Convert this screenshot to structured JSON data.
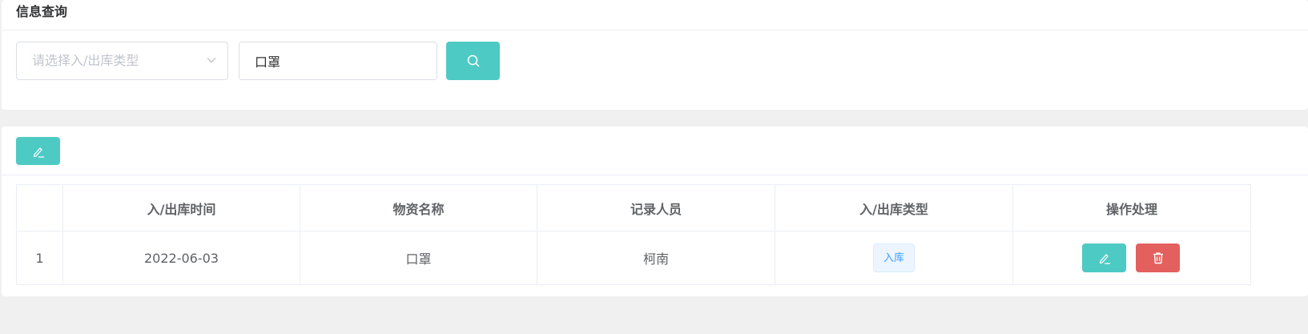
{
  "query": {
    "title": "信息查询",
    "type_select": {
      "placeholder": "请选择入/出库类型",
      "value": ""
    },
    "keyword_input": {
      "value": "口罩"
    },
    "search_icon": "search-icon"
  },
  "toolbar": {
    "add_icon": "edit-icon"
  },
  "table": {
    "columns": [
      "",
      "入/出库时间",
      "物资名称",
      "记录人员",
      "入/出库类型",
      "操作处理"
    ],
    "rows": [
      {
        "index": "1",
        "time": "2022-06-03",
        "name": "口罩",
        "recorder": "柯南",
        "type": "入库",
        "actions": [
          "edit-icon",
          "delete-icon"
        ]
      }
    ]
  },
  "colors": {
    "accent": "#4ecac4",
    "danger": "#e3605f",
    "tag_text": "#409eff",
    "tag_bg": "#ecf5ff",
    "page_bg": "#f0f0f0"
  }
}
